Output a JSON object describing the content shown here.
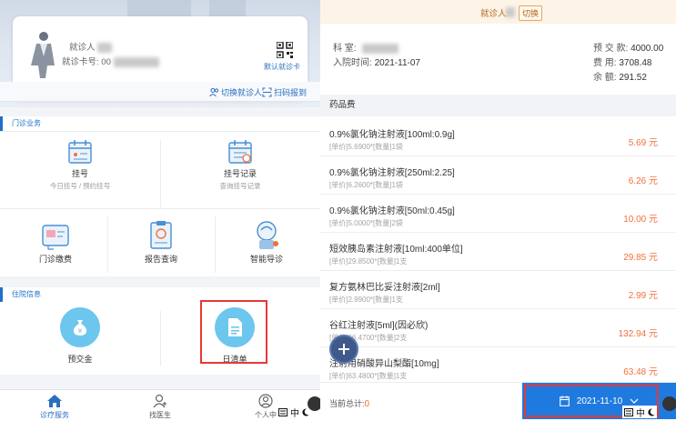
{
  "left": {
    "patient_card": {
      "visitor_label": "就诊人",
      "card_label": "就诊卡号:",
      "card_value_prefix": "00",
      "qr_label": "默认就诊卡"
    },
    "links": {
      "switch_patient": "切换就诊人",
      "scan_report": "扫码报到"
    },
    "outpatient": {
      "title": "门诊业务",
      "tiles": [
        {
          "label": "挂号",
          "sub": "今日挂号 / 预约挂号"
        },
        {
          "label": "挂号记录",
          "sub": "查询挂号记录"
        },
        {
          "label": "门诊缴费",
          "sub": ""
        },
        {
          "label": "报告查询",
          "sub": ""
        },
        {
          "label": "智能导诊",
          "sub": ""
        }
      ]
    },
    "inpatient": {
      "title": "住院信息",
      "tiles": [
        {
          "label": "预交金"
        },
        {
          "label": "日清单"
        }
      ]
    },
    "tabbar": {
      "tabs": [
        {
          "label": "诊疗服务"
        },
        {
          "label": "找医生"
        },
        {
          "label": "个人中"
        }
      ]
    },
    "ime": {
      "chars": "中"
    }
  },
  "right": {
    "top_bar": {
      "visitor_label": "就诊人:",
      "switch_label": "切换"
    },
    "info": {
      "dept_label": "科  室:",
      "admit_label": "入院时间:",
      "admit_value": "2021-11-07",
      "prepay_label": "预 交 款:",
      "prepay_value": "4000.00",
      "cost_label": "费    用:",
      "cost_value": "3708.48",
      "balance_label": "余    额:",
      "balance_value": "291.52"
    },
    "drug_header": "药品费",
    "items": [
      {
        "name": "0.9%氯化钠注射液[100ml:0.9g]",
        "detail": "[单价]5.6900*[数量]1袋",
        "price": "5.69 元"
      },
      {
        "name": "0.9%氯化钠注射液[250ml:2.25]",
        "detail": "[单价]6.2600*[数量]1袋",
        "price": "6.26 元"
      },
      {
        "name": "0.9%氯化钠注射液[50ml:0.45g]",
        "detail": "[单价]5.0000*[数量]2袋",
        "price": "10.00 元"
      },
      {
        "name": "短效胰岛素注射液[10ml:400单位]",
        "detail": "[单价]29.8500*[数量]1支",
        "price": "29.85 元"
      },
      {
        "name": "复方氨林巴比妥注射液[2ml]",
        "detail": "[单价]2.9900*[数量]1支",
        "price": "2.99 元"
      },
      {
        "name": "谷红注射液[5ml](因必欣)",
        "detail": "[单价]66.4700*[数量]2支",
        "price": "132.94 元"
      },
      {
        "name": "注射用硝酸异山梨酯[10mg]",
        "detail": "[单价]63.4800*[数量]1支",
        "price": "63.48 元"
      }
    ],
    "footer": {
      "total_label": "当前总计:",
      "total_value": "0",
      "date_value": "2021-11-10"
    },
    "ime": {
      "chars": "中"
    }
  },
  "colors": {
    "primary": "#1f7ae0",
    "price": "#f0703a",
    "highlight": "#e53935",
    "tile_circle": "#6cc6ee"
  }
}
